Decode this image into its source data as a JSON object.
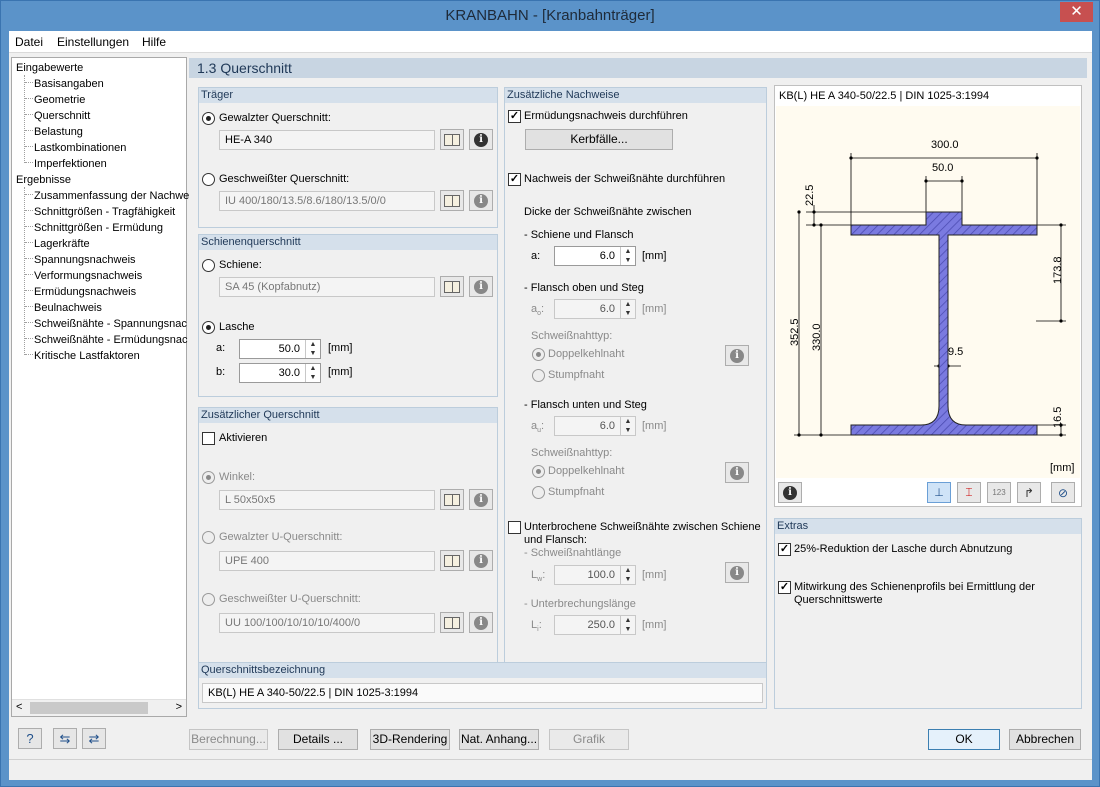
{
  "window": {
    "title": "KRANBAHN - [Kranbahnträger]",
    "close": "✕"
  },
  "menu": [
    "Datei",
    "Einstellungen",
    "Hilfe"
  ],
  "nav": {
    "root1": "Eingabewerte",
    "input_items": [
      "Basisangaben",
      "Geometrie",
      "Querschnitt",
      "Belastung",
      "Lastkombinationen",
      "Imperfektionen"
    ],
    "root2": "Ergebnisse",
    "result_items": [
      "Zusammenfassung der Nachwe",
      "Schnittgrößen - Tragfähigkeit",
      "Schnittgrößen - Ermüdung",
      "Lagerkräfte",
      "Spannungsnachweis",
      "Verformungsnachweis",
      "Ermüdungsnachweis",
      "Beulnachweis",
      "Schweißnähte - Spannungsnac",
      "Schweißnähte - Ermüdungsnac",
      "Kritische Lastfaktoren"
    ],
    "scroll_left": "<",
    "scroll_right": ">"
  },
  "section_title": "1.3 Querschnitt",
  "traeger": {
    "title": "Träger",
    "rolled_label": "Gewalzter Querschnitt:",
    "rolled_value": "HE-A 340",
    "welded_label": "Geschweißter Querschnitt:",
    "welded_value": "IU 400/180/13.5/8.6/180/13.5/0/0"
  },
  "schiene": {
    "title": "Schienenquerschnitt",
    "rail_label": "Schiene:",
    "rail_value": "SA 45 (Kopfabnutz)",
    "plate_label": "Lasche",
    "a_label": "a:",
    "a_value": "50.0",
    "a_unit": "[mm]",
    "b_label": "b:",
    "b_value": "30.0",
    "b_unit": "[mm]"
  },
  "zusatz": {
    "title": "Zusätzlicher Querschnitt",
    "activate": "Aktivieren",
    "angle_label": "Winkel:",
    "angle_value": "L 50x50x5",
    "rolled_u_label": "Gewalzter U-Querschnitt:",
    "rolled_u_value": "UPE 400",
    "welded_u_label": "Geschweißter U-Querschnitt:",
    "welded_u_value": "UU 100/100/10/10/10/400/0"
  },
  "nachweise": {
    "title": "Zusätzliche Nachweise",
    "fatigue": "Ermüdungsnachweis durchführen",
    "notch_btn": "Kerbfälle...",
    "weld": "Nachweis der Schweißnähte durchführen",
    "thickness": "Dicke der Schweißnähte zwischen",
    "rail_flange": "- Schiene und Flansch",
    "a_label": "a:",
    "a_value": "6.0",
    "unit": "[mm]",
    "top_flange": "- Flansch oben und Steg",
    "ao_label": "a",
    "ao_sub": "o",
    "ao_value": "6.0",
    "type_label": "Schweißnahttyp:",
    "double": "Doppelkehlnaht",
    "butt": "Stumpfnaht",
    "bottom_flange": "- Flansch unten und Steg",
    "au_label": "a",
    "au_sub": "u",
    "au_value": "6.0",
    "interrupted": "Unterbrochene Schweißnähte zwischen Schiene",
    "interrupted2": "und Flansch:",
    "seam_len": "- Schweißnahtlänge",
    "lw_label": "L",
    "lw_sub": "w",
    "lw_value": "100.0",
    "gap_len": "- Unterbrechungslänge",
    "li_label": "L",
    "li_sub": "i",
    "li_value": "250.0"
  },
  "preview": {
    "title": "KB(L) HE A 340-50/22.5 | DIN 1025-3:1994",
    "dims": {
      "w": "300.0",
      "plate": "50.0",
      "plate_t": "22.5",
      "upper": "173.8",
      "total": "352.5",
      "h": "330.0",
      "tw": "9.5",
      "tf": "16.5"
    },
    "unit": "[mm]"
  },
  "extras": {
    "title": "Extras",
    "reduction": "25%-Reduktion der Lasche durch Abnutzung",
    "rail_profile": "Mitwirkung des Schienenprofils bei Ermittlung der",
    "rail_profile2": "Querschnittswerte"
  },
  "bezeichnung": {
    "title": "Querschnittsbezeichnung",
    "value": "KB(L) HE A 340-50/22.5 | DIN 1025-3:1994"
  },
  "buttons": {
    "calc": "Berechnung...",
    "details": "Details ...",
    "render": "3D-Rendering",
    "annex": "Nat. Anhang...",
    "graphic": "Grafik",
    "ok": "OK",
    "cancel": "Abbrechen"
  },
  "colors": {
    "accent": "#5b93c9",
    "hatch": "#6b6bd6"
  }
}
